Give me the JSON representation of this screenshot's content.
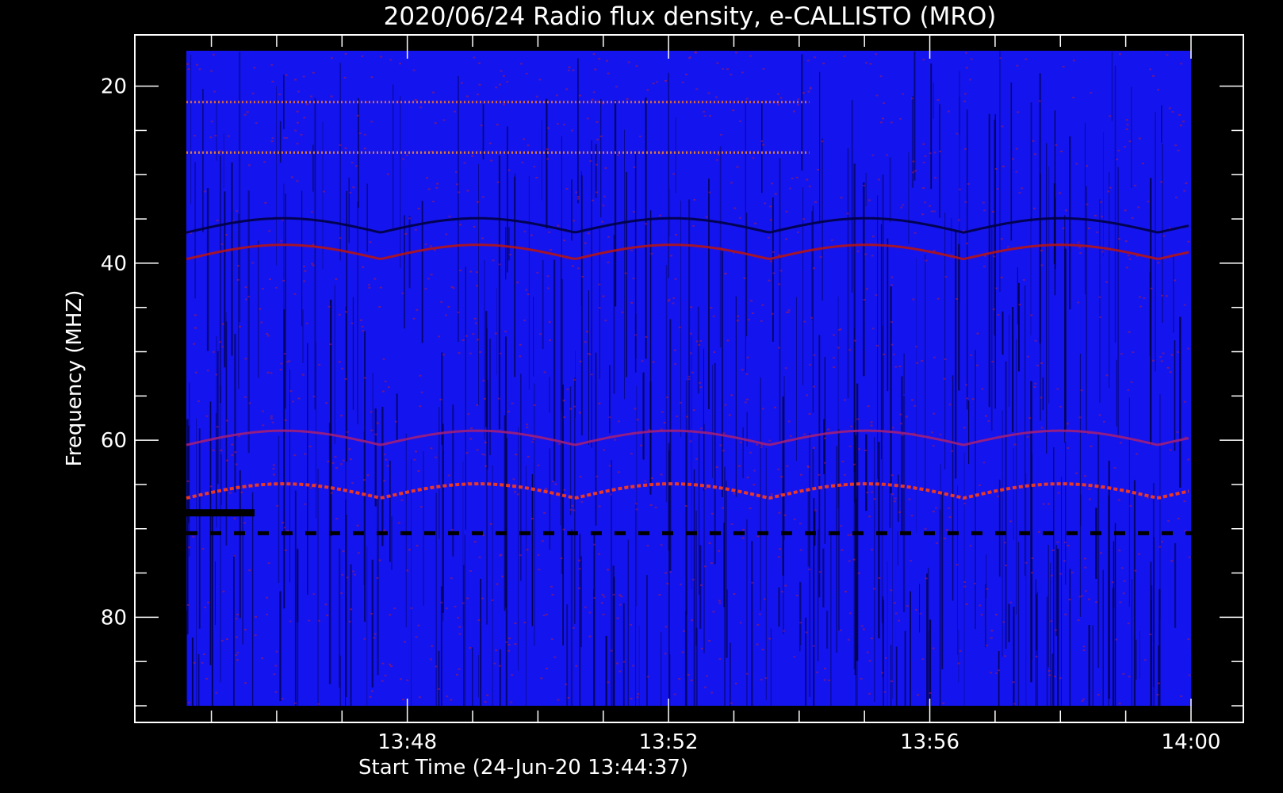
{
  "chart_data": {
    "type": "heatmap",
    "title": "2020/06/24  Radio flux density, e-CALLISTO (MRO)",
    "xlabel": "Start Time (24-Jun-20 13:44:37)",
    "ylabel": "Frequency (MHZ)",
    "x_start": "13:44:37",
    "x_end": "14:00:00",
    "xlim": [
      "13:44:37",
      "14:00:00"
    ],
    "x_ticks": [
      "13:48",
      "13:52",
      "13:56",
      "14:00"
    ],
    "ylim": [
      90,
      16
    ],
    "y_ticks": [
      20,
      40,
      60,
      80
    ],
    "y_inverted": true,
    "colormap": [
      "#000000",
      "#0000ff",
      "#c81e1e",
      "#ff8c00",
      "#ffff60"
    ],
    "features": [
      {
        "type": "wavy-band",
        "freq_mhz": 36,
        "color": "#000040"
      },
      {
        "type": "wavy-band",
        "freq_mhz": 39,
        "color": "#b41414"
      },
      {
        "type": "wavy-band",
        "freq_mhz": 60,
        "color": "#a01e78"
      },
      {
        "type": "wavy-band",
        "freq_mhz": 66,
        "color": "#ff3c14"
      },
      {
        "type": "dashed-line",
        "freq_mhz": 70.5,
        "color": "#000000"
      },
      {
        "type": "interference-band",
        "freq_mhz": 27.5,
        "color": "#ff8c1e"
      },
      {
        "type": "interference-band",
        "freq_mhz": 21.8,
        "color": "#ff781e"
      }
    ]
  },
  "colors": {
    "background": "#000000",
    "frame": "#ffffff",
    "text": "#ffffff"
  }
}
